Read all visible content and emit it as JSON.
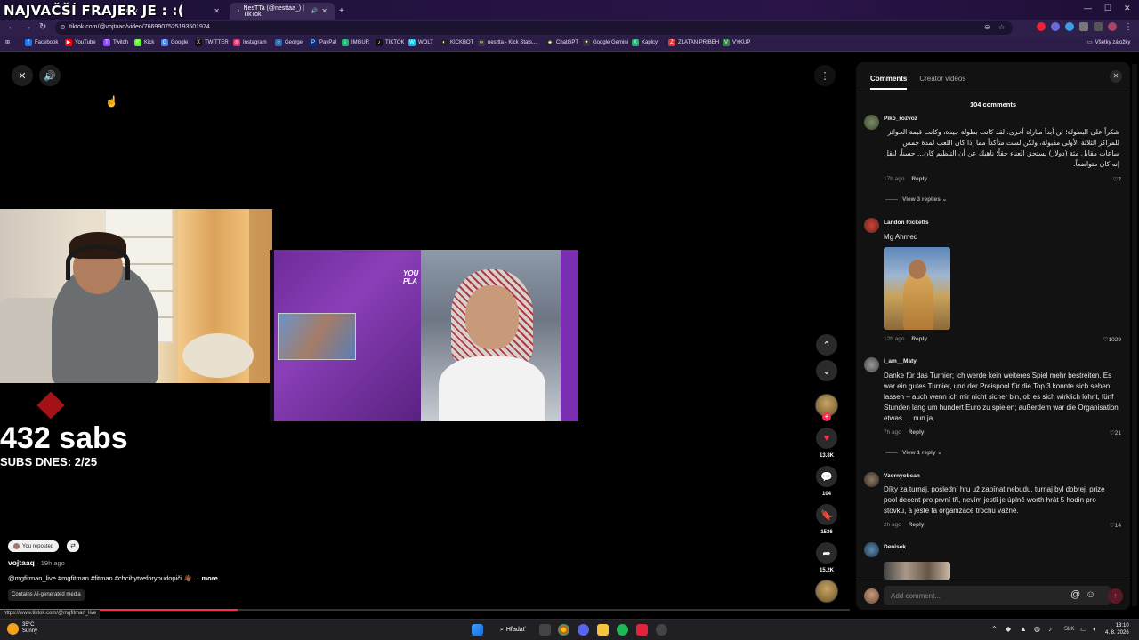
{
  "stream_overlay": {
    "title": "NAJVAČŠÍ FRAJER JE : :("
  },
  "browser": {
    "tabs": [
      {
        "label": "...ubo ok"
      },
      {
        "label": "NesTTa (@nesttaa_) | TikTok"
      }
    ],
    "new_tab": "+",
    "url": "tiktok.com/@vojtaaq/video/7669907525193501974",
    "bookmarks": [
      {
        "label": "Facebook",
        "color": "#1877f2",
        "glyph": "f"
      },
      {
        "label": "YouTube",
        "color": "#ff0000",
        "glyph": "▶"
      },
      {
        "label": "Twitch",
        "color": "#9146ff",
        "glyph": "T"
      },
      {
        "label": "Kick",
        "color": "#53fc18",
        "glyph": "K"
      },
      {
        "label": "Google",
        "color": "#4285f4",
        "glyph": "G"
      },
      {
        "label": "TWITTER",
        "color": "#111",
        "glyph": "X"
      },
      {
        "label": "Instagram",
        "color": "#e1306c",
        "glyph": "◎"
      },
      {
        "label": "George",
        "color": "#2a6ebb",
        "glyph": "○"
      },
      {
        "label": "PayPal",
        "color": "#003087",
        "glyph": "P"
      },
      {
        "label": "IMGUR",
        "color": "#1bb76e",
        "glyph": "i"
      },
      {
        "label": "TIKTOK",
        "color": "#111",
        "glyph": "♪"
      },
      {
        "label": "WOLT",
        "color": "#00c2e8",
        "glyph": "W"
      },
      {
        "label": "KICKBOT",
        "color": "#222",
        "glyph": "◐"
      },
      {
        "label": "nesttta - Kick Stats,...",
        "color": "#333",
        "glyph": "∞"
      },
      {
        "label": "ChatGPT",
        "color": "#222",
        "glyph": "◈"
      },
      {
        "label": "Google Gemini",
        "color": "#333",
        "glyph": "✦"
      },
      {
        "label": "Kaplcy",
        "color": "#1bb76e",
        "glyph": "K"
      },
      {
        "label": "ZLATAN PRIBEH",
        "color": "#d33",
        "glyph": "Z"
      },
      {
        "label": "VYKUP",
        "color": "#2a8a3a",
        "glyph": "V"
      }
    ],
    "all_bookmarks": "Všetky záložky"
  },
  "video": {
    "big_title": "432 sabs",
    "sub_title": "SUBS DNES: 2/25",
    "overlay_tag": "YOU PLA",
    "progress": 0.28,
    "repost_label": "You reposted",
    "author": "vojtaaq",
    "author_time": "· 19h ago",
    "caption": "@mgfitman_live #mgfitman #fitman #chcibytveforyoudopiči 👋🏾 ...",
    "more": "more",
    "ai_label": "Contains AI-generated media",
    "status_url": "https://www.tiktok.com/@mgfitman_live"
  },
  "actions": {
    "likes": "13.8K",
    "comments": "104",
    "saves": "1536",
    "shares": "15.2K"
  },
  "comments_panel": {
    "tab_comments": "Comments",
    "tab_creator": "Creator videos",
    "count": "104 comments",
    "comments": [
      {
        "user": "Piko_rozvoz",
        "text": "شكراً على البطولة؛ لن أبدأ مباراة أخرى. لقد كانت بطولة جيدة، وكانت قيمة الجوائز للمراكز الثلاثة الأولى مقبولة، ولكن لست متأكداً مما إذا كان اللعب لمدة خمس ساعات مقابل مئة (دولار) يستحق العناء حقاً؛ ناهيك عن أن التنظيم كان... حسناً، لنقل إنه كان متواضعاً.",
        "time": "17h ago",
        "reply": "Reply",
        "likes": "7",
        "view_replies": "View 3 replies"
      },
      {
        "user": "Landon Ricketts",
        "text": "Mg Ahmed",
        "time": "12h ago",
        "reply": "Reply",
        "likes": "1029"
      },
      {
        "user": "i_am__Maty",
        "text": "Danke für das Turnier; ich werde kein weiteres Spiel mehr bestreiten. Es war ein gutes Turnier, und der Preispool für die Top 3 konnte sich sehen lassen – auch wenn ich mir nicht sicher bin, ob es sich wirklich lohnt, fünf Stunden lang um hundert Euro zu spielen; außerdem war die Organisation etwas … nun ja.",
        "time": "7h ago",
        "reply": "Reply",
        "likes": "21",
        "view_replies": "View 1 reply"
      },
      {
        "user": "Vzornyobcan",
        "text": "Díky za turnaj, poslední hru už zapínat nebudu, turnaj byl dobrej, prize pool decent pro první tři, nevím jestli je úplně worth hrát 5 hodin pro stovku, a ještě ta organizace trochu vážně.",
        "time": "2h ago",
        "reply": "Reply",
        "likes": "14"
      },
      {
        "user": "Denisek"
      }
    ],
    "input_placeholder": "Add comment..."
  },
  "taskbar": {
    "temperature": "35°C",
    "weather": "Sunny",
    "search": "Hľadať",
    "lang": "SLK",
    "time": "18:10",
    "date": "4. 8. 2026"
  }
}
